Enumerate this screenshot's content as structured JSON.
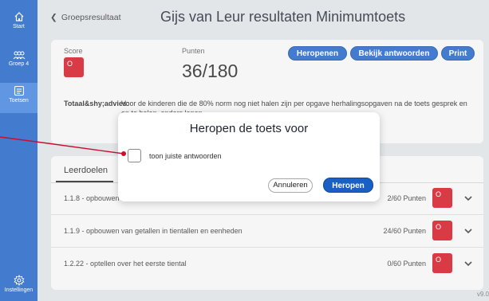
{
  "sidebar": {
    "items": [
      {
        "label": "Start",
        "icon": "home-icon"
      },
      {
        "label": "Groep 4",
        "icon": "group-icon"
      },
      {
        "label": "Toetsen",
        "icon": "tests-icon"
      },
      {
        "label": "Instellingen",
        "icon": "gear-icon"
      }
    ]
  },
  "header": {
    "back_label": "Groepsresultaat",
    "title": "Gijs van Leur resultaten Minimumtoets"
  },
  "score_card": {
    "score_label": "Score",
    "score_badge": "O",
    "punten_label": "Punten",
    "punten_value": "36/180",
    "buttons": {
      "heropenen": "Heropenen",
      "bekijk": "Bekijk antwoorden",
      "print": "Print"
    },
    "advice_label": "Totaal&shy;advies:",
    "advice_text": "Voor de kinderen die de 80% norm nog niet halen zijn per opgave herhalingsopgaven na de toets gesprek en en te halen, anders lopen"
  },
  "leerdoelen": {
    "tab_label": "Leerdoelen",
    "rows": [
      {
        "label": "1.1.8 - opbouwen",
        "punten": "2/60 Punten",
        "badge": "O"
      },
      {
        "label": "1.1.9 - opbouwen van getallen in tientallen en eenheden",
        "punten": "24/60 Punten",
        "badge": "O"
      },
      {
        "label": "1.2.22 - optellen over het eerste tiental",
        "punten": "0/60 Punten",
        "badge": "O"
      }
    ]
  },
  "modal": {
    "title": "Heropen de toets voor",
    "checkbox_label": "toon juiste antwoorden",
    "cancel_label": "Annuleren",
    "confirm_label": "Heropen"
  },
  "version": "v9.0",
  "colors": {
    "brand_blue": "#1a5fc4",
    "badge_red": "#d0101e",
    "pointer_red": "#c8102e"
  }
}
